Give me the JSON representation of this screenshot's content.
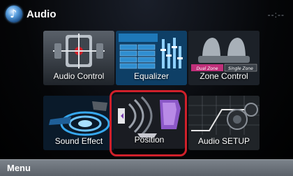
{
  "header": {
    "title": "Audio",
    "clock": "--:--"
  },
  "tiles": [
    {
      "label": "Audio Control",
      "icon": "audio-control-icon"
    },
    {
      "label": "Equalizer",
      "icon": "equalizer-icon"
    },
    {
      "label": "Zone Control",
      "icon": "zone-control-icon",
      "zone_tags": [
        "Dual Zone",
        "Single Zone"
      ]
    },
    {
      "label": "Sound Effect",
      "icon": "sound-effect-icon"
    },
    {
      "label": "Position",
      "icon": "position-icon"
    },
    {
      "label": "Audio SETUP",
      "icon": "audio-setup-icon"
    }
  ],
  "equalizer_preset_names": [
    "",
    "",
    "",
    "",
    "",
    "",
    "",
    ""
  ],
  "bottom_bar": {
    "menu_label": "Menu"
  },
  "colors": {
    "highlight": "#d0202a",
    "accent_blue": "#5aa0e0",
    "zone_pink": "#c0307a"
  }
}
